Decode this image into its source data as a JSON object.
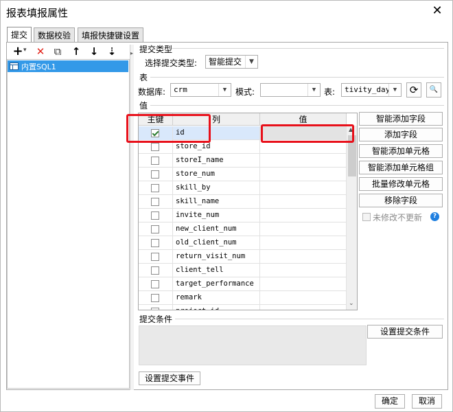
{
  "window": {
    "title": "报表填报属性",
    "close_glyph": "✕"
  },
  "tabs": [
    {
      "label": "提交"
    },
    {
      "label": "数据校验"
    },
    {
      "label": "填报快捷键设置"
    }
  ],
  "left_panel": {
    "toolbar": {
      "add": "+",
      "add_caret": "▾",
      "remove": "✕",
      "copy": "⧉",
      "up": "↑",
      "down": "↓",
      "sort": "⇣"
    },
    "items": [
      {
        "label": "内置SQL1",
        "selected": true
      }
    ]
  },
  "submit_type": {
    "section_label": "提交类型",
    "select_label": "选择提交类型:",
    "value": "智能提交"
  },
  "table_section": {
    "section_label": "表",
    "db_label": "数据库:",
    "db_value": "crm",
    "schema_label": "模式:",
    "schema_value": "",
    "table_label": "表:",
    "table_value": "tivity_day",
    "refresh_glyph": "⟳",
    "preview_glyph": "🔍"
  },
  "values": {
    "section_label": "值",
    "headers": {
      "key": "主键",
      "column": "列",
      "value": "值"
    },
    "rows": [
      {
        "column": "id",
        "key": true,
        "value": ""
      },
      {
        "column": "store_id",
        "key": false,
        "value": ""
      },
      {
        "column": "storeI_name",
        "key": false,
        "value": ""
      },
      {
        "column": "store_num",
        "key": false,
        "value": ""
      },
      {
        "column": "skill_by",
        "key": false,
        "value": ""
      },
      {
        "column": "skill_name",
        "key": false,
        "value": ""
      },
      {
        "column": "invite_num",
        "key": false,
        "value": ""
      },
      {
        "column": "new_client_num",
        "key": false,
        "value": ""
      },
      {
        "column": "old_client_num",
        "key": false,
        "value": ""
      },
      {
        "column": "return_visit_num",
        "key": false,
        "value": ""
      },
      {
        "column": "client_tell",
        "key": false,
        "value": ""
      },
      {
        "column": "target_performance",
        "key": false,
        "value": ""
      },
      {
        "column": "remark",
        "key": false,
        "value": ""
      },
      {
        "column": "project_id",
        "key": false,
        "value": ""
      }
    ],
    "buttons": {
      "smart_add_field": "智能添加字段",
      "add_field": "添加字段",
      "smart_add_cell": "智能添加单元格",
      "smart_add_cell_group": "智能添加单元格组",
      "batch_edit_cell": "批量修改单元格",
      "remove_field": "移除字段"
    },
    "unmodified_no_update": "未修改不更新",
    "help_glyph": "?"
  },
  "condition": {
    "section_label": "提交条件",
    "set_condition_button": "设置提交条件",
    "set_event_button": "设置提交事件"
  },
  "footer": {
    "ok": "确定",
    "cancel": "取消"
  }
}
